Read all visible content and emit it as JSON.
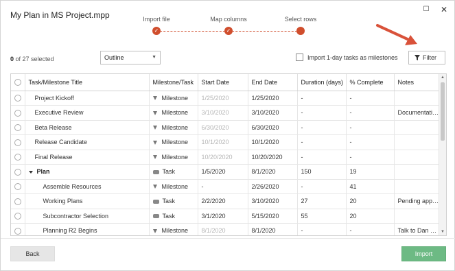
{
  "window": {
    "title": "My Plan in MS Project.mpp",
    "maximize_icon": "maximize-icon",
    "close_icon": "close-icon"
  },
  "stepper": {
    "steps": [
      {
        "label": "Import file",
        "state": "done"
      },
      {
        "label": "Map columns",
        "state": "done"
      },
      {
        "label": "Select rows",
        "state": "current"
      }
    ],
    "accent_color": "#d04e2d"
  },
  "toolbar": {
    "selected_count": "0",
    "selected_suffix": " of 27 selected",
    "outline_value": "Outline",
    "milestone_checkbox_label": "Import 1-day tasks as milestones",
    "milestone_checked": false,
    "filter_label": "Filter"
  },
  "table": {
    "headers": [
      "Task/Milestone Title",
      "Milestone/Task",
      "Start Date",
      "End Date",
      "Duration (days)",
      "% Complete",
      "Notes"
    ],
    "rows": [
      {
        "title": "Project Kickoff",
        "type": "Milestone",
        "start": "1/25/2020",
        "end": "1/25/2020",
        "duration": "-",
        "pct": "-",
        "notes": ""
      },
      {
        "title": "Executive Review",
        "type": "Milestone",
        "start": "3/10/2020",
        "end": "3/10/2020",
        "duration": "-",
        "pct": "-",
        "notes": "Documentation Required"
      },
      {
        "title": "Beta Release",
        "type": "Milestone",
        "start": "6/30/2020",
        "end": "6/30/2020",
        "duration": "-",
        "pct": "-",
        "notes": ""
      },
      {
        "title": "Release Candidate",
        "type": "Milestone",
        "start": "10/1/2020",
        "end": "10/1/2020",
        "duration": "-",
        "pct": "-",
        "notes": ""
      },
      {
        "title": "Final Release",
        "type": "Milestone",
        "start": "10/20/2020",
        "end": "10/20/2020",
        "duration": "-",
        "pct": "-",
        "notes": ""
      },
      {
        "title": "Plan",
        "type": "Task",
        "start": "1/5/2020",
        "end": "8/1/2020",
        "duration": "150",
        "pct": "19",
        "notes": ""
      },
      {
        "title": "Assemble Resources",
        "type": "Milestone",
        "start": "-",
        "end": "2/26/2020",
        "duration": "-",
        "pct": "41",
        "notes": ""
      },
      {
        "title": "Working Plans",
        "type": "Task",
        "start": "2/2/2020",
        "end": "3/10/2020",
        "duration": "27",
        "pct": "20",
        "notes": "Pending approval"
      },
      {
        "title": "Subcontractor Selection",
        "type": "Task",
        "start": "3/1/2020",
        "end": "5/15/2020",
        "duration": "55",
        "pct": "20",
        "notes": ""
      },
      {
        "title": "Planning R2 Begins",
        "type": "Milestone",
        "start": "8/1/2020",
        "end": "8/1/2020",
        "duration": "-",
        "pct": "-",
        "notes": "Talk to Dan about budget"
      }
    ]
  },
  "footer": {
    "back_label": "Back",
    "import_label": "Import",
    "import_color": "#6dba84"
  }
}
